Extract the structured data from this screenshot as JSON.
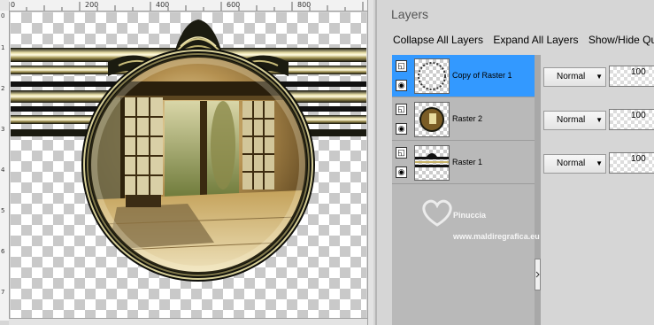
{
  "ruler": {
    "top_labels": [
      "0",
      "200",
      "400",
      "600",
      "800"
    ],
    "left_labels": [
      "0",
      "1",
      "2",
      "3",
      "4",
      "5",
      "6",
      "7"
    ]
  },
  "panel": {
    "title": "Layers",
    "toolbar": {
      "collapse_label": "Collapse All Layers",
      "expand_label": "Expand All Layers",
      "showhide_label": "Show/Hide Quick"
    }
  },
  "layers": [
    {
      "name": "Copy of Raster 1",
      "blend": "Normal",
      "opacity": "100",
      "selected": true
    },
    {
      "name": "Raster 2",
      "blend": "Normal",
      "opacity": "100",
      "selected": false
    },
    {
      "name": "Raster 1",
      "blend": "Normal",
      "opacity": "100",
      "selected": false
    }
  ],
  "watermark": {
    "name": "Pinuccia",
    "site": "www.maldiregrafica.eu"
  },
  "colors": {
    "selection": "#3399ff",
    "gold": "#c8b46a",
    "dark": "#1b1b10"
  }
}
